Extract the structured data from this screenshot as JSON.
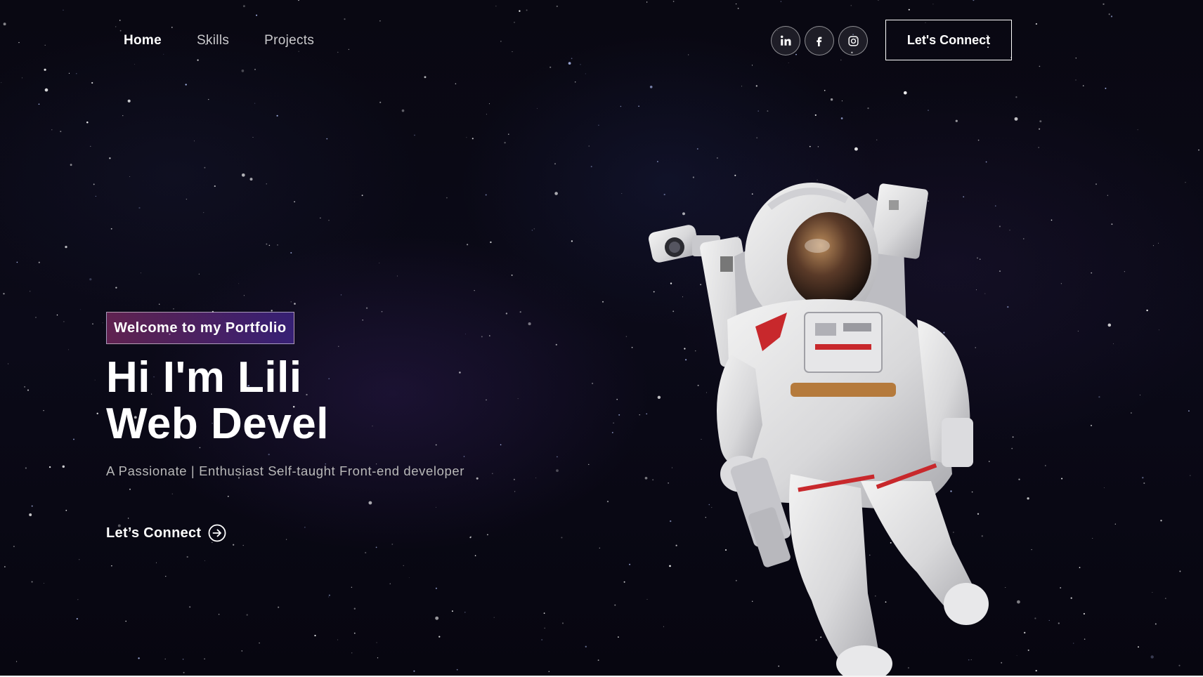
{
  "nav": {
    "links": [
      {
        "label": "Home",
        "active": true
      },
      {
        "label": "Skills",
        "active": false
      },
      {
        "label": "Projects",
        "active": false
      }
    ],
    "social": [
      {
        "icon": "linkedin-icon"
      },
      {
        "icon": "facebook-icon"
      },
      {
        "icon": "instagram-icon"
      }
    ],
    "connect_label": "Let's Connect"
  },
  "hero": {
    "tagline": "Welcome to my Portfolio",
    "headline_line1": "Hi I'm Lili",
    "headline_line2": "Web Devel",
    "subtitle": "A Passionate | Enthusiast Self-taught Front-end developer",
    "cta_label": "Let’s Connect",
    "cta_icon": "arrow-right-circle-icon"
  },
  "colors": {
    "background": "#0b0a18",
    "tagline_gradient_start": "#aa367c",
    "tagline_gradient_end": "#4a2fbd",
    "text": "#ffffff",
    "subtitle": "#b8b8b8"
  },
  "illustration": "astronaut-image"
}
